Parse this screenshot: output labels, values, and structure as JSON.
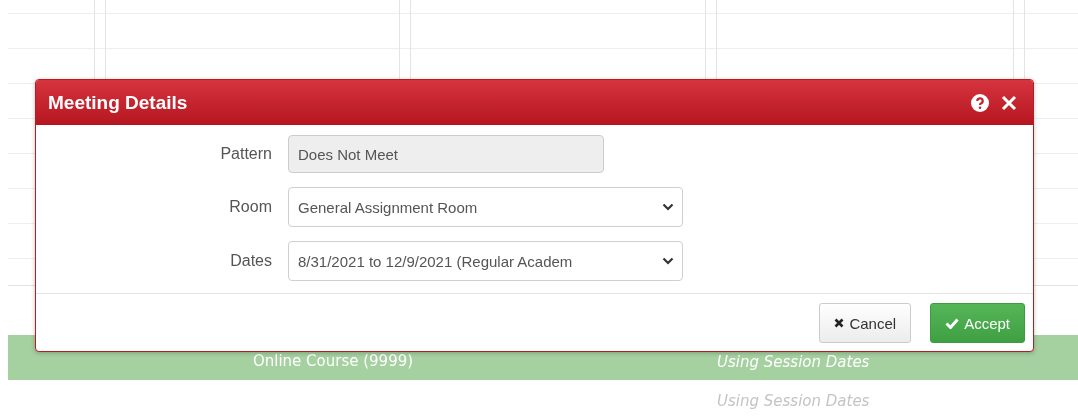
{
  "dialog": {
    "title": "Meeting Details",
    "fields": [
      {
        "kind": "readonly",
        "label": "Pattern",
        "value": "Does Not Meet"
      },
      {
        "kind": "select",
        "label": "Room",
        "value": "General Assignment Room"
      },
      {
        "kind": "select",
        "label": "Dates",
        "value": "8/31/2021 to 12/9/2021 (Regular Academ"
      }
    ],
    "buttons": [
      {
        "kind": "cancel",
        "label": "Cancel"
      },
      {
        "kind": "accept",
        "label": "Accept"
      }
    ]
  },
  "rows": [
    {
      "kind": "highlight",
      "room": "Online Course (9999)",
      "dates": "Using Session Dates"
    },
    {
      "kind": "plain",
      "dates": "Using Session Dates"
    }
  ]
}
